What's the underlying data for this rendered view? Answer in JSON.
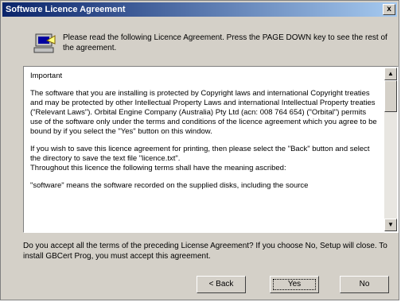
{
  "window": {
    "title": "Software Licence Agreement",
    "close_glyph": "x"
  },
  "header": {
    "icon": "setup-computer-icon",
    "instruction": "Please read the following Licence Agreement. Press the PAGE DOWN key to see the rest of the agreement."
  },
  "licence": {
    "paragraphs": [
      "Important",
      "The software that you are installing is protected by Copyright laws and international Copyright treaties and may be protected by other Intellectual Property Laws and international Intellectual Property treaties (\"Relevant Laws\"). Orbital Engine Company (Australia) Pty Ltd (acn: 008 764 654) (\"Orbital\") permits use of the software only under the terms and conditions of the licence agreement which you agree to be bound by if you select the \"Yes\" button on this window.",
      "If you wish to save this licence agreement for printing, then please select the \"Back\" button and select the directory to save the text file \"licence.txt\".\nThroughout this licence the following terms shall have the meaning ascribed:",
      "\"software\" means the software recorded on the supplied disks, including the source"
    ]
  },
  "question": "Do you accept all the terms of the preceding License Agreement? If you choose No, Setup will close. To install GBCert Prog, you must accept this agreement.",
  "buttons": {
    "back": "< Back",
    "yes": "Yes",
    "no": "No"
  }
}
